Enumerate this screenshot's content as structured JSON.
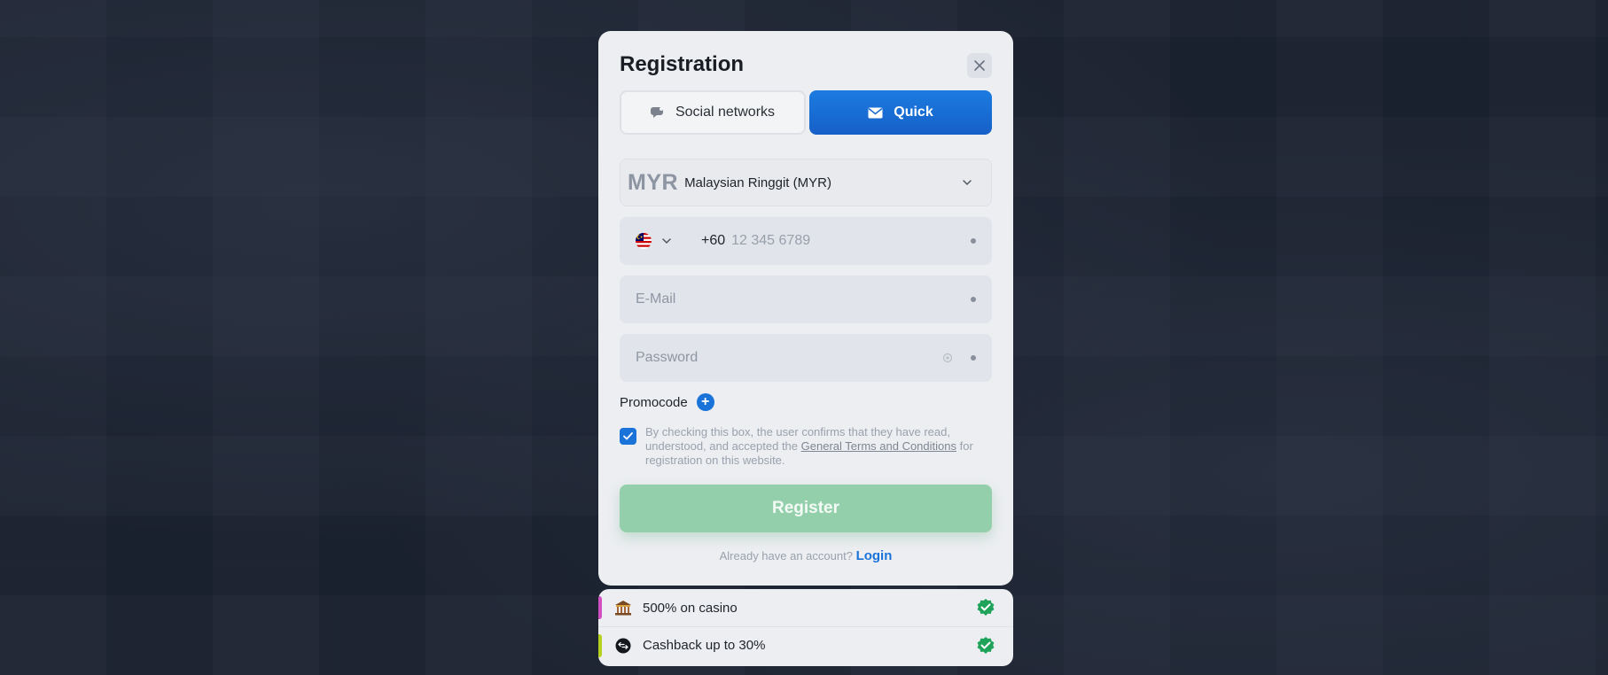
{
  "modal": {
    "title": "Registration",
    "tabs": [
      {
        "label": "Social networks",
        "icon": "chat-bubble-icon",
        "active": false
      },
      {
        "label": "Quick",
        "icon": "envelope-icon",
        "active": true
      }
    ]
  },
  "form": {
    "currency": {
      "code": "MYR",
      "name": "Malaysian Ringgit (MYR)"
    },
    "phone": {
      "country_code": "+60",
      "placeholder": "12 345 6789",
      "flag": "malaysia-flag-icon"
    },
    "email": {
      "placeholder": "E-Mail"
    },
    "password": {
      "placeholder": "Password"
    },
    "promocode_label": "Promocode",
    "consent": {
      "checked": true,
      "text_before": "By checking this box, the user confirms that they have read, understood, and accepted the ",
      "link_text": "General Terms and Conditions",
      "text_after": " for registration on this website."
    },
    "register_label": "Register",
    "login_prompt": "Already have an account?",
    "login_label": "Login"
  },
  "bonuses": [
    {
      "label": "500% on casino",
      "icon": "casino-building-icon",
      "accent": "#d14fc1"
    },
    {
      "label": "Cashback up to 30%",
      "icon": "cashback-coin-icon",
      "accent": "#b6d11e"
    }
  ],
  "colors": {
    "accent_blue": "#1a73d9",
    "register_green": "#93cfaa",
    "check_green": "#1fa35a",
    "background": "#1c2331"
  }
}
